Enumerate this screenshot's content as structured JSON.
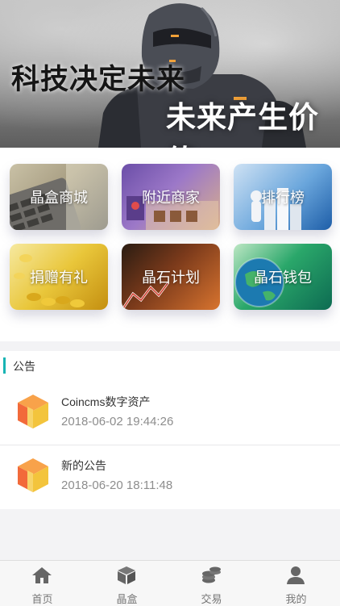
{
  "banner": {
    "line1": "科技决定未来",
    "line2": "未来产生价值"
  },
  "grid": {
    "items": [
      {
        "label": "晶盒商城"
      },
      {
        "label": "附近商家"
      },
      {
        "label": "排行榜"
      },
      {
        "label": "捐赠有礼"
      },
      {
        "label": "晶石计划"
      },
      {
        "label": "晶石钱包"
      }
    ]
  },
  "notice": {
    "title": "公告",
    "items": [
      {
        "title": "Coincms数字资产",
        "date": "2018-06-02 19:44:26",
        "icon": "box-icon"
      },
      {
        "title": "新的公告",
        "date": "2018-06-20 18:11:48",
        "icon": "box-icon"
      }
    ]
  },
  "tabbar": {
    "items": [
      {
        "label": "首页",
        "icon": "home-icon"
      },
      {
        "label": "晶盒",
        "icon": "cube-icon"
      },
      {
        "label": "交易",
        "icon": "coins-icon"
      },
      {
        "label": "我的",
        "icon": "user-icon"
      }
    ]
  },
  "colors": {
    "accent": "#17b4b4",
    "tab_icon": "#666666"
  }
}
